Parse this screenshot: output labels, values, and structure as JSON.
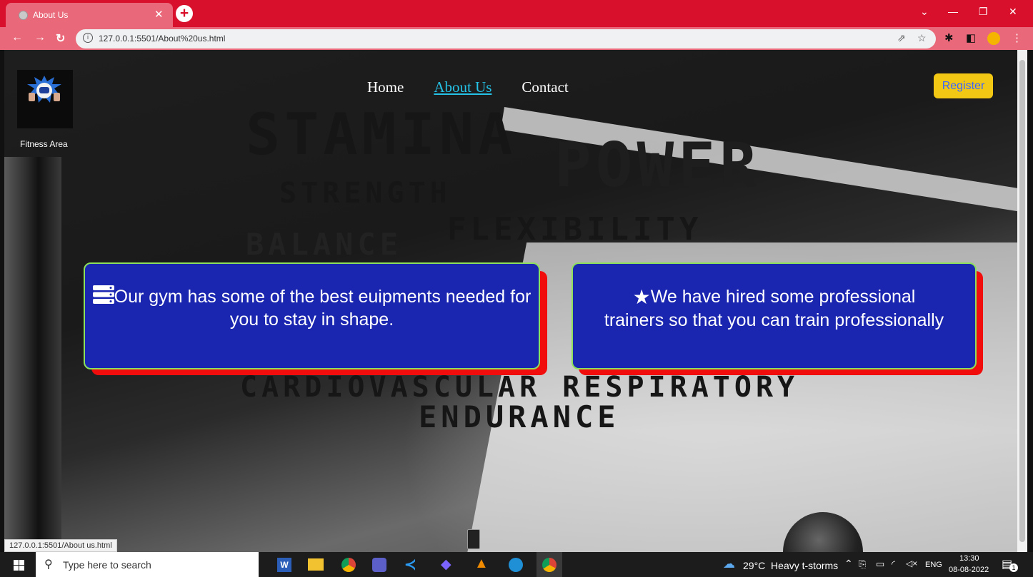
{
  "browser": {
    "tab_title": "About Us",
    "url": "127.0.0.1:5501/About%20us.html",
    "status_url": "127.0.0.1:5501/About us.html"
  },
  "site": {
    "logo_text": "Fitness Area",
    "nav": [
      {
        "label": "Home",
        "active": false
      },
      {
        "label": "About Us",
        "active": true
      },
      {
        "label": "Contact",
        "active": false
      }
    ],
    "register_label": "Register",
    "wall_words": [
      "STAMINA",
      "POWER",
      "STRENGTH",
      "FLEXIBILITY",
      "BALANCE",
      "CARDIOVASCULAR RESPIRATORY",
      "ENDURANCE"
    ],
    "cards": [
      {
        "icon": "server-icon",
        "text": "Our gym has some of the best euipments needed for you to stay in shape."
      },
      {
        "icon": "star-icon",
        "text": "We have hired some professional trainers so that you can train professionally"
      }
    ],
    "accent_colors": {
      "card_bg": "#1a25b0",
      "card_shadow": "#f20d0d",
      "card_border": "#8ce05c",
      "register_bg": "#f3c814",
      "active_link": "#25c3e8"
    }
  },
  "taskbar": {
    "search_placeholder": "Type here to search",
    "weather": "29°C  Heavy t-storms",
    "lang": "ENG",
    "time": "13:30",
    "date": "08-08-2022",
    "notifications": "1"
  }
}
